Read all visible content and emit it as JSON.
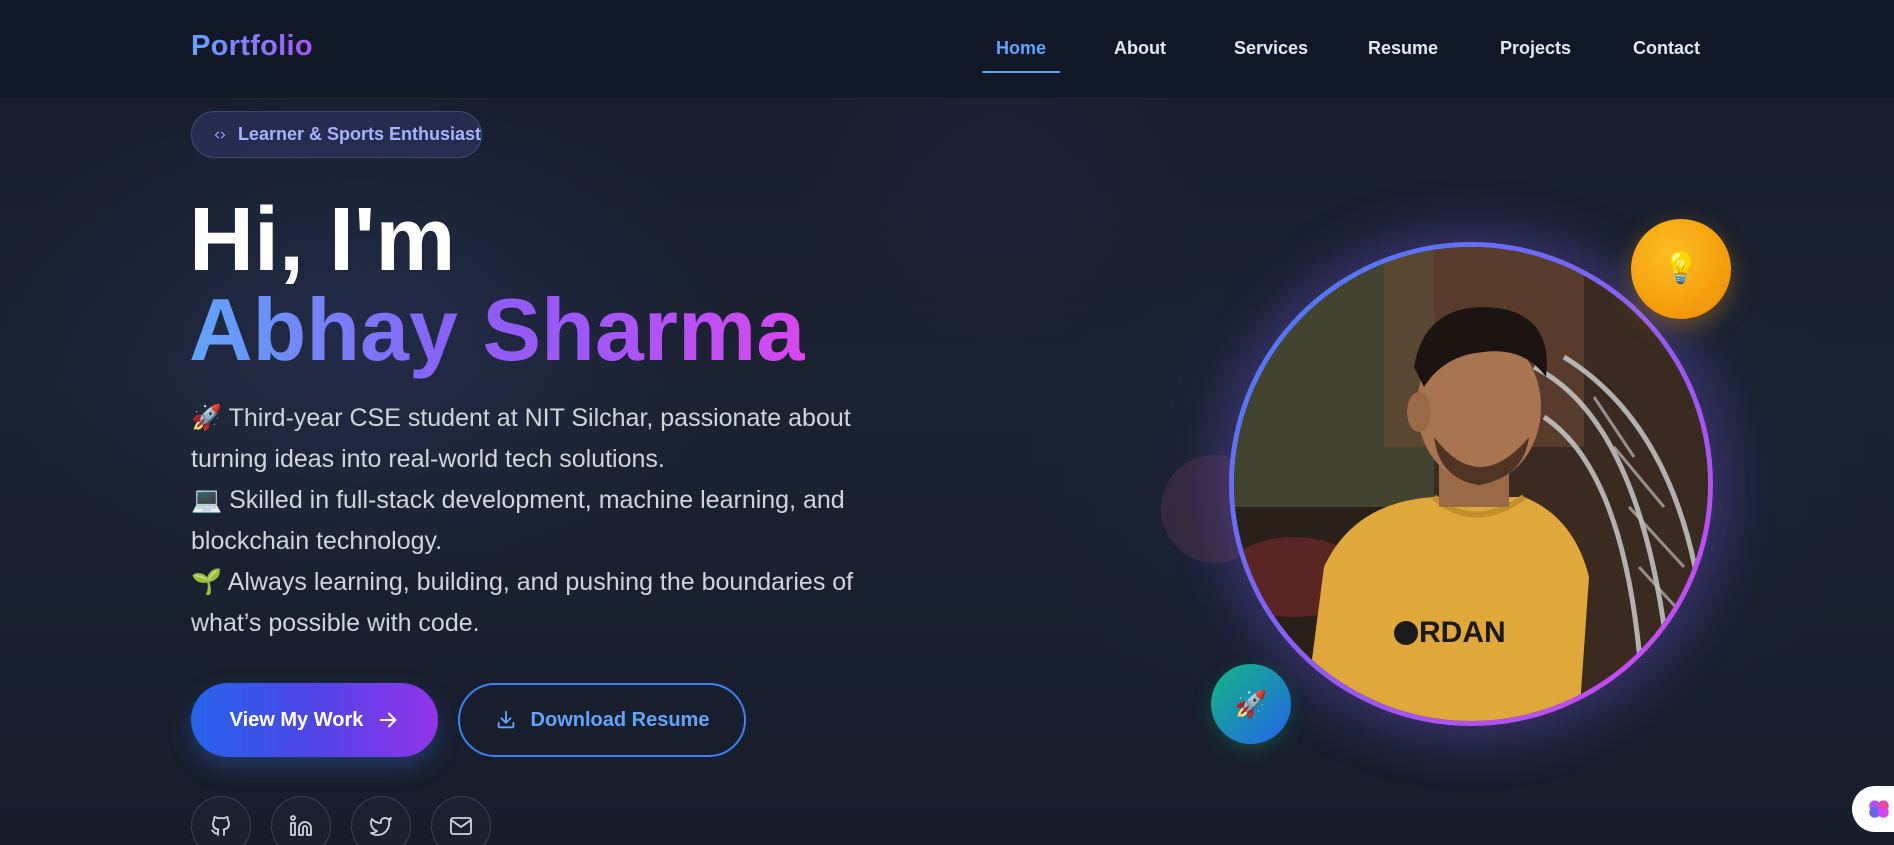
{
  "nav": {
    "logo": "Portfolio",
    "links": [
      {
        "label": "Home",
        "active": true
      },
      {
        "label": "About"
      },
      {
        "label": "Services"
      },
      {
        "label": "Resume"
      },
      {
        "label": "Projects"
      },
      {
        "label": "Contact"
      }
    ]
  },
  "hero": {
    "badge": "Learner & Sports Enthusiast",
    "greeting": "Hi, I'm",
    "name": "Abhay Sharma",
    "description": [
      "🚀 Third-year CSE student at NIT Silchar, passionate about",
      "turning ideas into real-world tech solutions.",
      "💻 Skilled in full-stack development, machine learning, and",
      "blockchain technology.",
      "🌱 Always learning, building, and pushing the boundaries of",
      "what’s possible with code."
    ],
    "primary_button": "View My Work",
    "secondary_button": "Download Resume"
  },
  "profile": {
    "shirt_text": "RDAN",
    "float_top_icon": "💡",
    "float_bottom_icon": "🚀"
  },
  "social": [
    {
      "icon": "github-icon"
    },
    {
      "icon": "linkedin-icon"
    },
    {
      "icon": "twitter-icon"
    },
    {
      "icon": "mail-icon"
    }
  ],
  "colors": {
    "accent_blue": "#60a5fa",
    "accent_purple": "#a855f7",
    "background": "#141a29",
    "navbar": "#111827"
  }
}
